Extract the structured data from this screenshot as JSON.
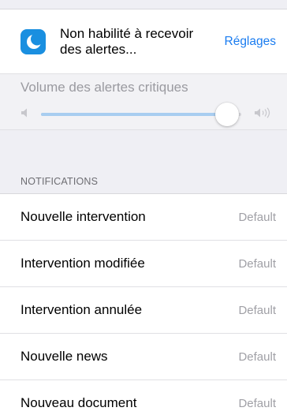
{
  "alert": {
    "message": "Non habilité à recevoir des alertes...",
    "action_label": "Réglages",
    "icon": "moon-icon"
  },
  "volume": {
    "label": "Volume des alertes critiques",
    "level": 0.93,
    "min_icon": "speaker-low-icon",
    "max_icon": "speaker-high-icon"
  },
  "notifications": {
    "header": "NOTIFICATIONS",
    "items": [
      {
        "label": "Nouvelle intervention",
        "value": "Default"
      },
      {
        "label": "Intervention modifiée",
        "value": "Default"
      },
      {
        "label": "Intervention annulée",
        "value": "Default"
      },
      {
        "label": "Nouvelle news",
        "value": "Default"
      },
      {
        "label": "Nouveau document",
        "value": "Default"
      }
    ]
  },
  "colors": {
    "accent": "#1a7cf0",
    "app_icon_bg": "#1a8fe0",
    "slider_fill": "#a8cdf0"
  }
}
